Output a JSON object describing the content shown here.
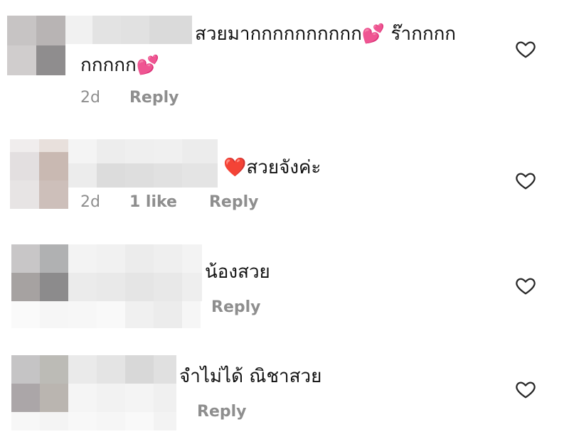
{
  "comments": [
    {
      "line1": "สวยมากกกกกกกกกก",
      "emoji1": "💕",
      "line1b": " ร๊ากกกก",
      "line2": "กกกกก",
      "emoji2": "💕",
      "time": "2d",
      "reply_label": "Reply"
    },
    {
      "emoji": "❤️",
      "text": "สวยจังค่ะ",
      "time": "2d",
      "likes": "1 like",
      "reply_label": "Reply"
    },
    {
      "text": "น้องสวย",
      "reply_label": "Reply"
    },
    {
      "text": "จำไม่ได้ ณิชาสวย",
      "reply_label": "Reply"
    }
  ],
  "icons": {
    "like": "heart-outline-icon"
  },
  "colors": {
    "text": "#111111",
    "meta": "#8e8e8e",
    "heart": "#262626"
  }
}
